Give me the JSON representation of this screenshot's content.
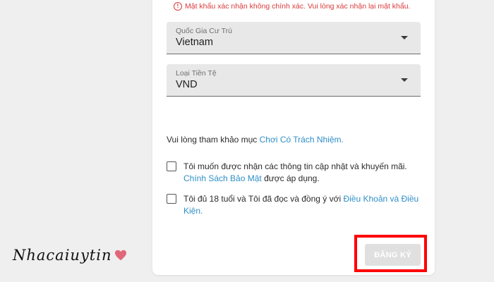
{
  "form": {
    "error_icon": "!",
    "error_message": "Mật khẩu xác nhận không chính xác. Vui lòng xác nhận lại mật khẩu.",
    "country": {
      "label": "Quốc Gia Cư Trú",
      "value": "Vietnam"
    },
    "currency": {
      "label": "Loại Tiền Tệ",
      "value": "VND"
    },
    "responsible": {
      "text": "Vui lòng tham khảo mục ",
      "link": "Chơi Có Trách Nhiệm."
    },
    "opt_in": {
      "text": "Tôi muốn được nhận các thông tin cập nhật và khuyến mãi.",
      "link": "Chính Sách Bảo Mật",
      "suffix": " được áp dụng.",
      "checked": false
    },
    "age_terms": {
      "text": "Tôi đủ 18 tuổi và Tôi đã đọc và đồng ý với ",
      "link": "Điều Khoản và Điều Kiện.",
      "checked": false
    },
    "submit_label": "ĐĂNG KÝ"
  },
  "watermark": {
    "text": "Nhacaiuytin",
    "heart_color": "#e0677a"
  },
  "colors": {
    "error": "#d93a3a",
    "link": "#2f8fc7",
    "highlight": "#ff0000",
    "button_disabled": "#e0e0e0"
  }
}
